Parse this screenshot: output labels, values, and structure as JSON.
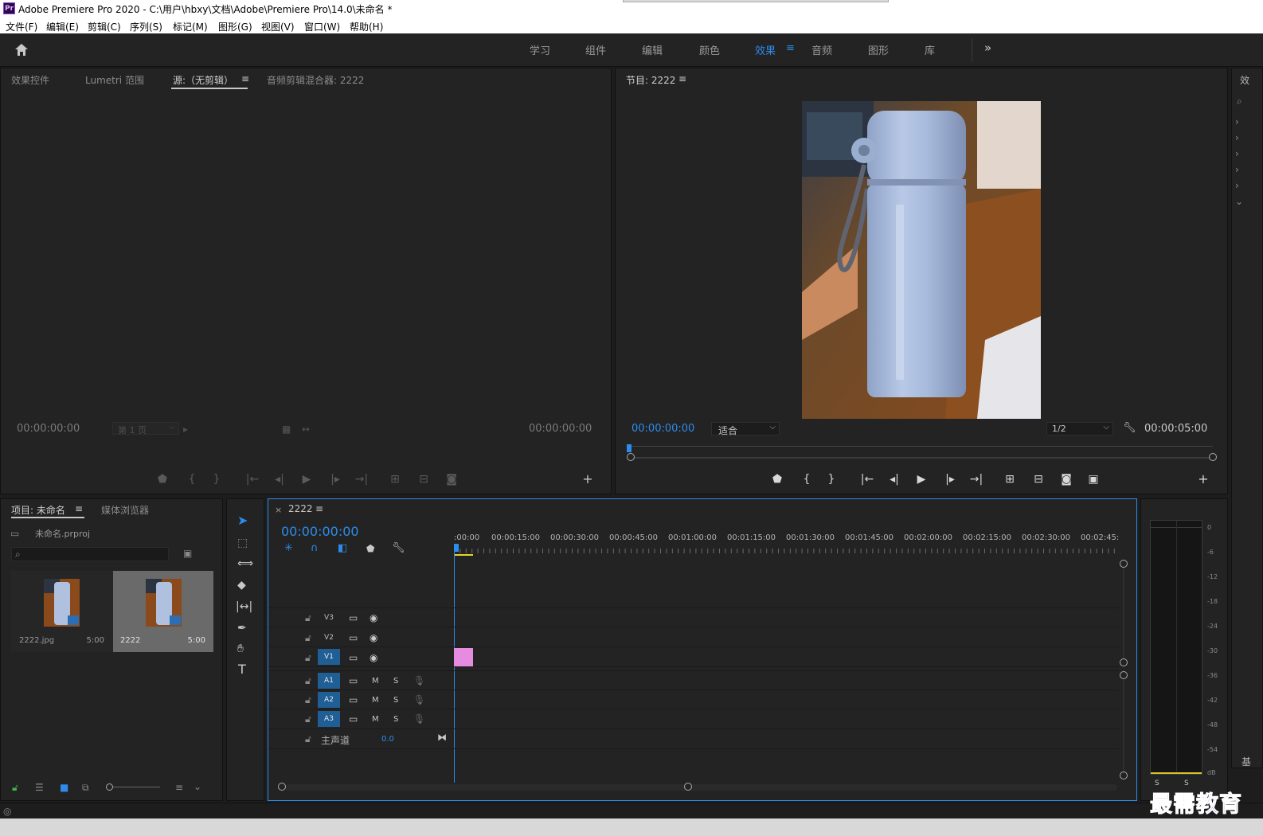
{
  "window": {
    "logo_text": "Pr",
    "title": "Adobe Premiere Pro 2020 - C:\\用户\\hbxy\\文档\\Adobe\\Premiere Pro\\14.0\\未命名 *"
  },
  "menu": [
    "文件(F)",
    "编辑(E)",
    "剪辑(C)",
    "序列(S)",
    "标记(M)",
    "图形(G)",
    "视图(V)",
    "窗口(W)",
    "帮助(H)"
  ],
  "workspaces": {
    "items": [
      "学习",
      "组件",
      "编辑",
      "颜色",
      "效果",
      "音频",
      "图形",
      "库"
    ],
    "active": "效果",
    "more": "»"
  },
  "source_panel": {
    "tabs": [
      "效果控件",
      "Lumetri 范围",
      "源:（无剪辑）",
      "音频剪辑混合器: 2222"
    ],
    "active_tab": "源:（无剪辑）",
    "timecode_left": "00:00:00:00",
    "page_select": "第 1 页",
    "timecode_right": "00:00:00:00"
  },
  "program_panel": {
    "tab": "节目: 2222",
    "timecode": "00:00:00:00",
    "fit": "适合",
    "resolution": "1/2",
    "duration": "00:00:05:00"
  },
  "project_panel": {
    "tabs": [
      "项目: 未命名",
      "媒体浏览器"
    ],
    "project_file": "未命名.prproj",
    "items": [
      {
        "name": "2222.jpg",
        "duration": "5:00",
        "selected": false
      },
      {
        "name": "2222",
        "duration": "5:00",
        "selected": true
      }
    ]
  },
  "timeline": {
    "tab": "2222",
    "close": "×",
    "timecode": "00:00:00:00",
    "ruler": [
      ":00:00",
      "00:00:15:00",
      "00:00:30:00",
      "00:00:45:00",
      "00:01:00:00",
      "00:01:15:00",
      "00:01:30:00",
      "00:01:45:00",
      "00:02:00:00",
      "00:02:15:00",
      "00:02:30:00",
      "00:02:45:"
    ],
    "video_tracks": [
      "V3",
      "V2",
      "V1"
    ],
    "audio_tracks": [
      "A1",
      "A2",
      "A3"
    ],
    "mute_label": "M",
    "solo_label": "S",
    "master": {
      "label": "主声道",
      "value": "0.0"
    },
    "clip_color": "#e58be0"
  },
  "meter": {
    "scale": [
      "0",
      "-6",
      "-12",
      "-18",
      "-24",
      "-30",
      "-36",
      "-42",
      "-48",
      "-54",
      "dB"
    ],
    "solo": [
      "S",
      "S"
    ]
  },
  "watermark": "最需教育",
  "colors": {
    "accent": "#2d8ceb",
    "track_on": "#1f5f96",
    "clip": "#e58be0"
  }
}
